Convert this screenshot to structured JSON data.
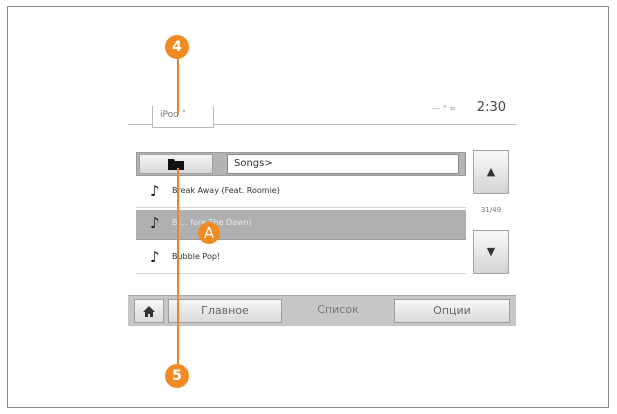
{
  "topbar": {
    "source_label": "iPod ˅",
    "status_text": "–– ° ≈",
    "time": "2:30"
  },
  "browser": {
    "path": "Songs>",
    "songs": [
      {
        "title": "Break Away (Feat. Roomie)",
        "selected": false
      },
      {
        "title": "Bl… fore The Dawn)",
        "selected": true
      },
      {
        "title": "Bubble Pop!",
        "selected": false
      }
    ],
    "page_indicator": "31/49"
  },
  "nav": {
    "main_label": "Главное",
    "list_label": "Список",
    "options_label": "Опции"
  },
  "callouts": {
    "c4": "4",
    "c5": "5",
    "cA": "A"
  }
}
